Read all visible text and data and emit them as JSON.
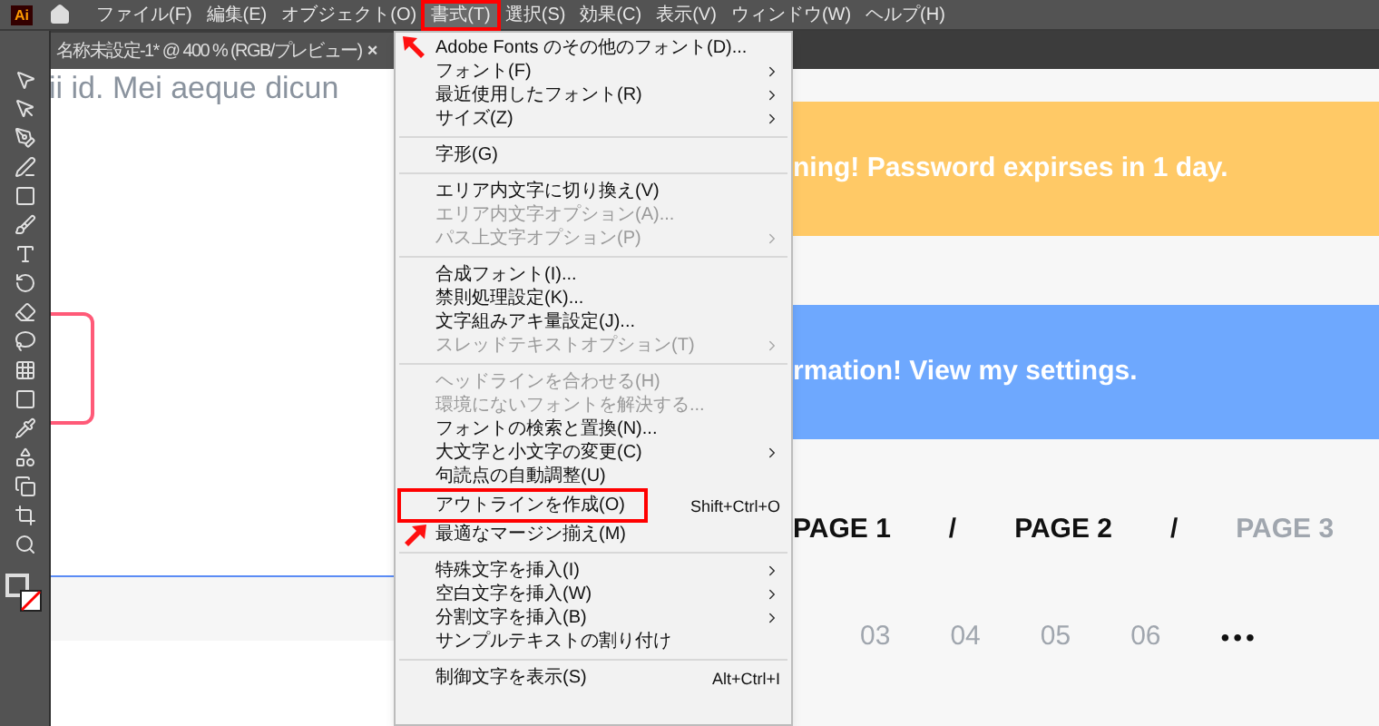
{
  "app_logo": "Ai",
  "menubar": [
    {
      "label": "ファイル(F)",
      "highlighted": false
    },
    {
      "label": "編集(E)",
      "highlighted": false
    },
    {
      "label": "オブジェクト(O)",
      "highlighted": false
    },
    {
      "label": "書式(T)",
      "highlighted": true
    },
    {
      "label": "選択(S)",
      "highlighted": false
    },
    {
      "label": "効果(C)",
      "highlighted": false
    },
    {
      "label": "表示(V)",
      "highlighted": false
    },
    {
      "label": "ウィンドウ(W)",
      "highlighted": false
    },
    {
      "label": "ヘルプ(H)",
      "highlighted": false
    }
  ],
  "document_tab": {
    "title": "名称未設定-1* @ 400 % (RGB/プレビュー)",
    "close": "×"
  },
  "menu": [
    {
      "kind": "item",
      "label": "Adobe Fonts のその他のフォント(D)...",
      "disabled": false,
      "submenu": false,
      "highlighted": false
    },
    {
      "kind": "item",
      "label": "フォント(F)",
      "disabled": false,
      "submenu": true,
      "highlighted": false
    },
    {
      "kind": "item",
      "label": "最近使用したフォント(R)",
      "disabled": false,
      "submenu": true,
      "highlighted": false
    },
    {
      "kind": "item",
      "label": "サイズ(Z)",
      "disabled": false,
      "submenu": true,
      "highlighted": false
    },
    {
      "kind": "separator"
    },
    {
      "kind": "item",
      "label": "字形(G)",
      "disabled": false,
      "submenu": false,
      "highlighted": false
    },
    {
      "kind": "separator"
    },
    {
      "kind": "item",
      "label": "エリア内文字に切り換え(V)",
      "disabled": false,
      "submenu": false,
      "highlighted": false
    },
    {
      "kind": "item",
      "label": "エリア内文字オプション(A)...",
      "disabled": true,
      "submenu": false,
      "highlighted": false
    },
    {
      "kind": "item",
      "label": "パス上文字オプション(P)",
      "disabled": true,
      "submenu": true,
      "highlighted": false
    },
    {
      "kind": "separator"
    },
    {
      "kind": "item",
      "label": "合成フォント(I)...",
      "disabled": false,
      "submenu": false,
      "highlighted": false
    },
    {
      "kind": "item",
      "label": "禁則処理設定(K)...",
      "disabled": false,
      "submenu": false,
      "highlighted": false
    },
    {
      "kind": "item",
      "label": "文字組みアキ量設定(J)...",
      "disabled": false,
      "submenu": false,
      "highlighted": false
    },
    {
      "kind": "item",
      "label": "スレッドテキストオプション(T)",
      "disabled": true,
      "submenu": true,
      "highlighted": false
    },
    {
      "kind": "separator"
    },
    {
      "kind": "item",
      "label": "ヘッドラインを合わせる(H)",
      "disabled": true,
      "submenu": false,
      "highlighted": false
    },
    {
      "kind": "item",
      "label": "環境にないフォントを解決する...",
      "disabled": true,
      "submenu": false,
      "highlighted": false
    },
    {
      "kind": "item",
      "label": "フォントの検索と置換(N)...",
      "disabled": false,
      "submenu": false,
      "highlighted": false
    },
    {
      "kind": "item",
      "label": "大文字と小文字の変更(C)",
      "disabled": false,
      "submenu": true,
      "highlighted": false
    },
    {
      "kind": "item",
      "label": "句読点の自動調整(U)",
      "disabled": false,
      "submenu": false,
      "highlighted": false
    },
    {
      "kind": "item",
      "label": "アウトラインを作成(O)",
      "shortcut": "Shift+Ctrl+O",
      "disabled": false,
      "submenu": false,
      "highlighted": true
    },
    {
      "kind": "item",
      "label": "最適なマージン揃え(M)",
      "disabled": false,
      "submenu": false,
      "highlighted": false
    },
    {
      "kind": "separator"
    },
    {
      "kind": "item",
      "label": "特殊文字を挿入(I)",
      "disabled": false,
      "submenu": true,
      "highlighted": false
    },
    {
      "kind": "item",
      "label": "空白文字を挿入(W)",
      "disabled": false,
      "submenu": true,
      "highlighted": false
    },
    {
      "kind": "item",
      "label": "分割文字を挿入(B)",
      "disabled": false,
      "submenu": true,
      "highlighted": false
    },
    {
      "kind": "item",
      "label": "サンプルテキストの割り付け",
      "disabled": false,
      "submenu": false,
      "highlighted": false
    },
    {
      "kind": "separator"
    },
    {
      "kind": "item",
      "label": "制御文字を表示(S)",
      "shortcut": "Alt+Ctrl+I",
      "disabled": false,
      "submenu": false,
      "highlighted": false
    }
  ],
  "canvas": {
    "body_text": "ii id. Mei aeque dicun",
    "alerts": [
      {
        "text": "ning! Password expirses in 1 day.",
        "color": "#ffc966"
      },
      {
        "text": "rmation! View my settings.",
        "color": "#6ea8fe"
      }
    ],
    "breadcrumb": [
      {
        "kind": "page",
        "label": "PAGE 1",
        "current": false
      },
      {
        "kind": "divider",
        "label": "/"
      },
      {
        "kind": "page",
        "label": "PAGE 2",
        "current": false
      },
      {
        "kind": "divider",
        "label": "/"
      },
      {
        "kind": "page",
        "label": "PAGE 3",
        "current": true
      }
    ],
    "pagination": [
      {
        "kind": "page",
        "label": "03"
      },
      {
        "kind": "page",
        "label": "04"
      },
      {
        "kind": "page",
        "label": "05"
      },
      {
        "kind": "page",
        "label": "06"
      },
      {
        "kind": "ellipsis",
        "label": "•••"
      }
    ]
  }
}
